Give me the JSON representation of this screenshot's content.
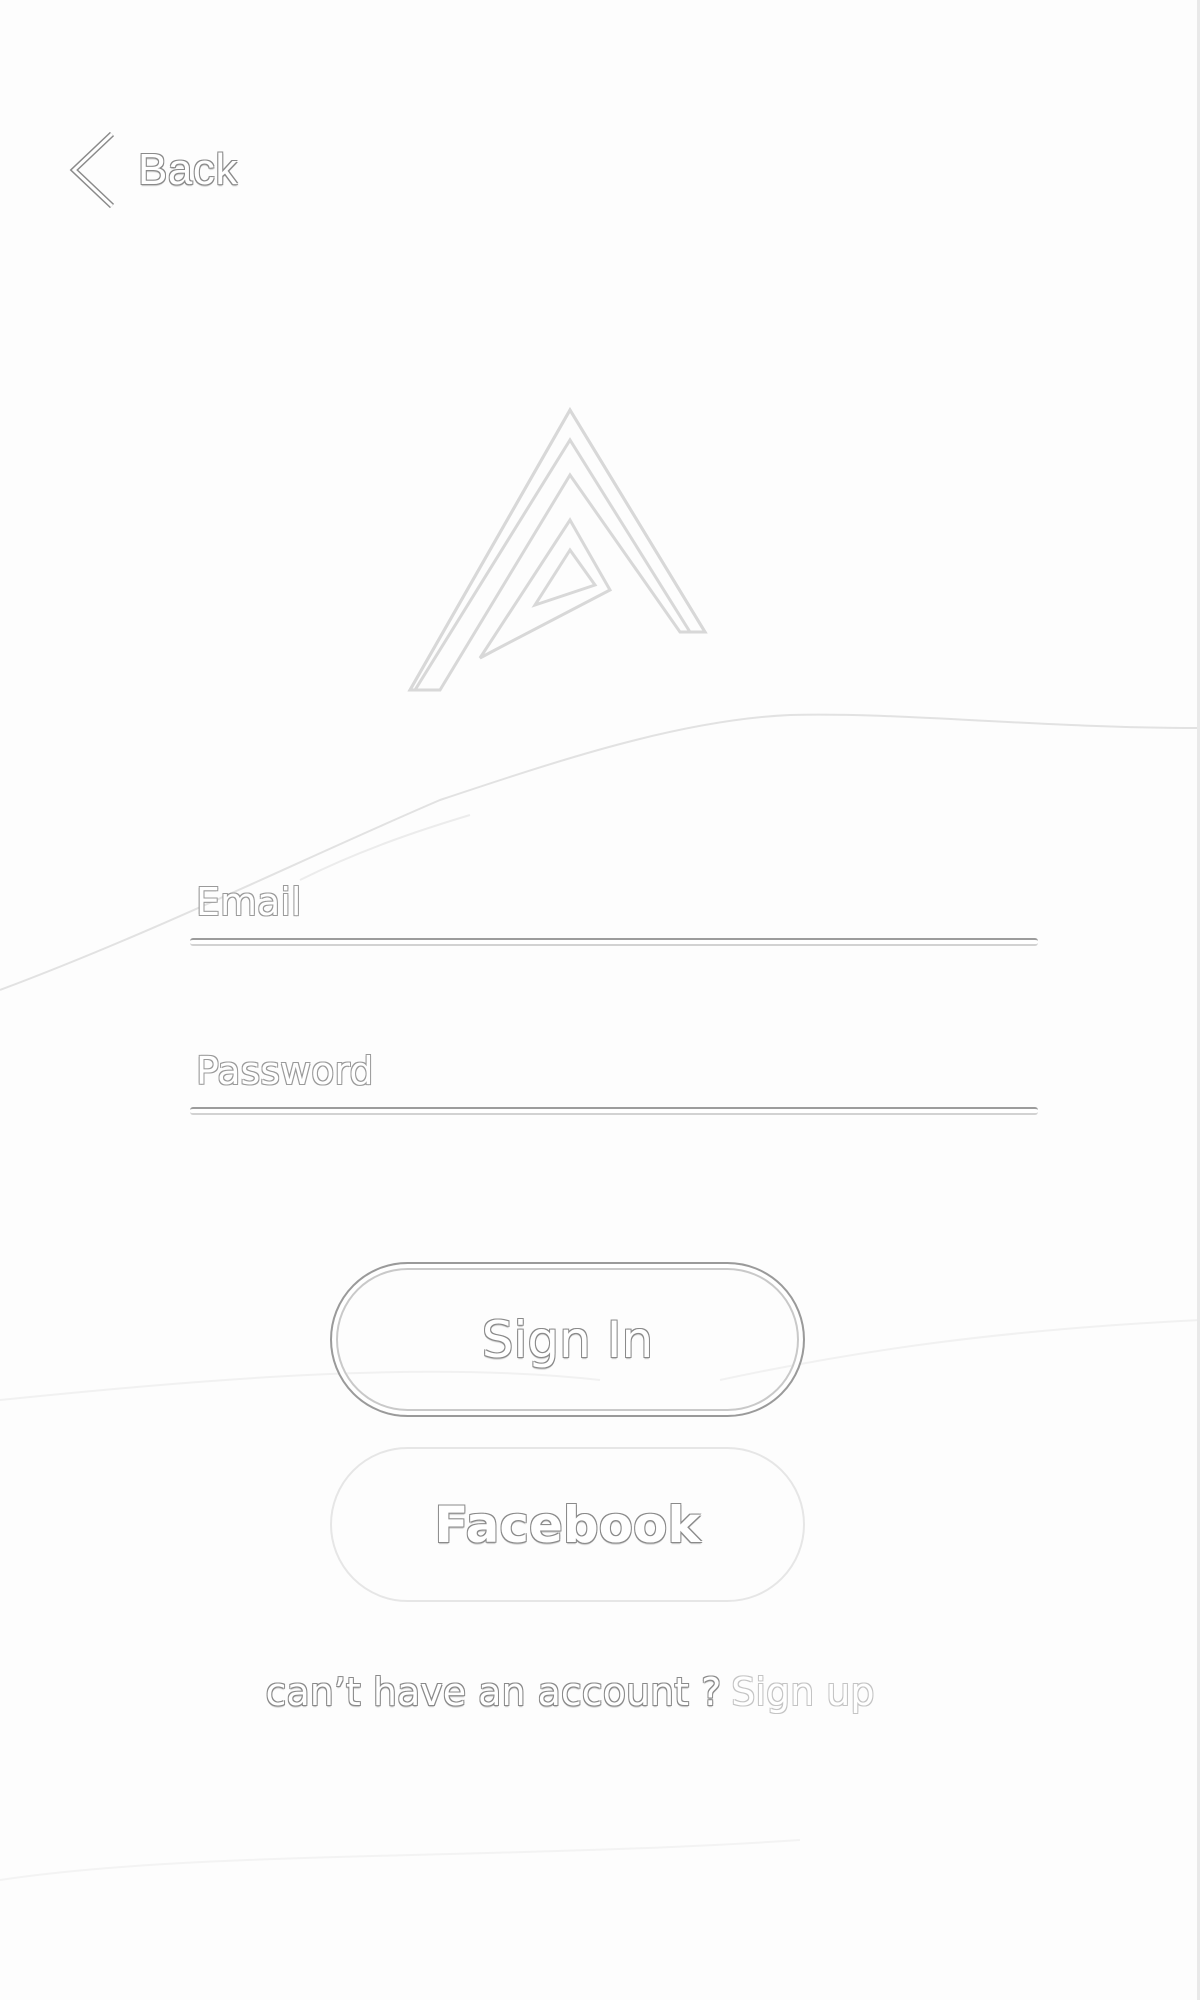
{
  "navigation": {
    "back_label": "Back"
  },
  "logo": {
    "icon": "triangle-a-logo"
  },
  "form": {
    "email_placeholder": "Email",
    "email_value": "",
    "password_placeholder": "Password",
    "password_value": ""
  },
  "actions": {
    "sign_in_label": "Sign In",
    "facebook_label": "Facebook"
  },
  "footer": {
    "prompt_text": "can’t have an account ?",
    "signup_label": "Sign up"
  },
  "colors": {
    "background": "#fdfdfd",
    "outline": "#8a8a8a",
    "faint_outline": "#c4c4c4"
  }
}
